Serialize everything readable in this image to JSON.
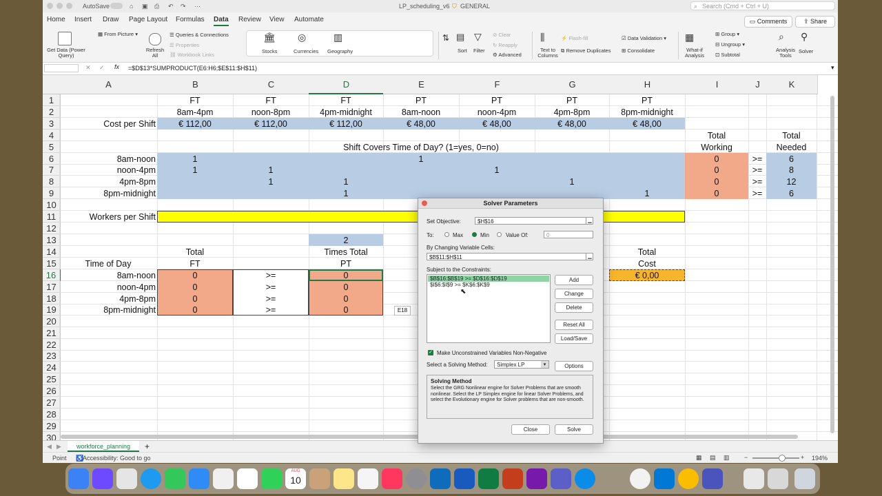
{
  "app": {
    "title": "LP_scheduling_v6",
    "sensitivity": "GENERAL",
    "autosave_label": "AutoSave",
    "search_placeholder": "Search (Cmd + Ctrl + U)"
  },
  "menu": {
    "items": [
      "Home",
      "Insert",
      "Draw",
      "Page Layout",
      "Formulas",
      "Data",
      "Review",
      "View",
      "Automate"
    ],
    "active": "Data",
    "comments_label": "Comments",
    "share_label": "Share"
  },
  "ribbon": {
    "get_data": "Get Data (Power Query)",
    "from_picture": "From Picture",
    "refresh_all": "Refresh All",
    "queries": "Queries & Connections",
    "properties": "Properties",
    "workbook_links": "Workbook Links",
    "stocks": "Stocks",
    "currencies": "Currencies",
    "geography": "Geography",
    "sort": "Sort",
    "filter": "Filter",
    "clear": "Clear",
    "reapply": "Reapply",
    "advanced": "Advanced",
    "text_to_columns": "Text to Columns",
    "flash_fill": "Flash-fill",
    "remove_duplicates": "Remove Duplicates",
    "data_validation": "Data Validation",
    "consolidate": "Consolidate",
    "what_if": "What-if Analysis",
    "group": "Group",
    "ungroup": "Ungroup",
    "subtotal": "Subtotal",
    "analysis_tools": "Analysis Tools",
    "solver": "Solver"
  },
  "formula_bar": {
    "name_box": "",
    "fx": "fx",
    "formula": "=$D$13*SUMPRODUCT(E6:H6;$E$11:$H$11)"
  },
  "columns": [
    "A",
    "B",
    "C",
    "D",
    "E",
    "F",
    "G",
    "H",
    "I",
    "J",
    "K"
  ],
  "rows": [
    "1",
    "2",
    "3",
    "4",
    "5",
    "6",
    "7",
    "8",
    "9",
    "10",
    "11",
    "12",
    "13",
    "14",
    "15",
    "16",
    "17",
    "18",
    "19",
    "20",
    "21",
    "22",
    "23",
    "24",
    "25",
    "26",
    "27",
    "28",
    "29",
    "30"
  ],
  "cells": {
    "B1": "FT",
    "C1": "FT",
    "D1": "FT",
    "E1": "PT",
    "F1": "PT",
    "G1": "PT",
    "H1": "PT",
    "B2": "8am-4pm",
    "C2": "noon-8pm",
    "D2": "4pm-midnight",
    "E2": "8am-noon",
    "F2": "noon-4pm",
    "G2": "4pm-8pm",
    "H2": "8pm-midnight",
    "A3": "Cost per Shift",
    "B3": "€ 112,00",
    "C3": "€ 112,00",
    "D3": "€ 112,00",
    "E3": "€ 48,00",
    "F3": "€ 48,00",
    "G3": "€ 48,00",
    "H3": "€ 48,00",
    "I4": "Total",
    "K4": "Total",
    "D5": "Shift Covers Time of Day? (1=yes, 0=no)",
    "I5": "Working",
    "K5": "Needed",
    "A6": "8am-noon",
    "B6": "1",
    "E6": "1",
    "I6": "0",
    "J6": ">=",
    "K6": "6",
    "A7": "noon-4pm",
    "B7": "1",
    "C7": "1",
    "F7": "1",
    "I7": "0",
    "J7": ">=",
    "K7": "8",
    "A8": "4pm-8pm",
    "C8": "1",
    "D8": "1",
    "G8": "1",
    "I8": "0",
    "J8": ">=",
    "K8": "12",
    "A9": "8pm-midnight",
    "D9": "1",
    "H9": "1",
    "I9": "0",
    "J9": ">=",
    "K9": "6",
    "A11": "Workers per Shift",
    "D13": "2",
    "B14": "Total",
    "D14": "Times Total",
    "H14": "Total",
    "A15": "Time of Day",
    "B15": "FT",
    "D15": "PT",
    "H15": "Cost",
    "A16": "8am-noon",
    "B16": "0",
    "C16": ">=",
    "D16": "0",
    "H16": "€ 0,00",
    "A17": "noon-4pm",
    "B17": "0",
    "C17": ">=",
    "D17": "0",
    "A18": "4pm-8pm",
    "B18": "0",
    "C18": ">=",
    "D18": "0",
    "A19": "8pm-midnight",
    "B19": "0",
    "C19": ">=",
    "D19": "0"
  },
  "cell_tooltip": "E18",
  "colors": {
    "blue": "#b8cce4",
    "salmon": "#f1a98a",
    "yellow": "#ffff00",
    "orange": "#f7b52c",
    "excel_green": "#1f7a45"
  },
  "sheet_tab": "workforce_planning",
  "status": {
    "mode": "Point",
    "accessibility": "Accessibility: Good to go",
    "zoom": "194%"
  },
  "solver": {
    "title": "Solver Parameters",
    "set_objective_label": "Set Objective:",
    "objective_value": "$H$16",
    "to_label": "To:",
    "max_label": "Max",
    "min_label": "Min",
    "value_of_label": "Value Of:",
    "value_of_value": "0",
    "changing_cells_label": "By Changing Variable Cells:",
    "changing_cells_value": "$B$11:$H$11",
    "constraints_label": "Subject to the Constraints:",
    "constraints": [
      "$B$16:$B$19 >= $D$16:$D$19",
      "$I$6:$I$9 >= $K$6:$K$9"
    ],
    "add": "Add",
    "change": "Change",
    "delete": "Delete",
    "reset_all": "Reset All",
    "load_save": "Load/Save",
    "nonneg_label": "Make Unconstrained Variables Non-Negative",
    "method_label": "Select a Solving Method:",
    "method_value": "Simplex LP",
    "options": "Options",
    "solving_method_title": "Solving Method",
    "solving_method_text": "Select the GRG Nonlinear engine for Solver Problems that are smooth nonlinear. Select the LP Simplex engine for linear Solver Problems, and select the Evolutionary engine for Solver problems that are non-smooth.",
    "close": "Close",
    "solve": "Solve"
  },
  "dock": {
    "calendar_month": "AUG",
    "calendar_day": "10"
  }
}
